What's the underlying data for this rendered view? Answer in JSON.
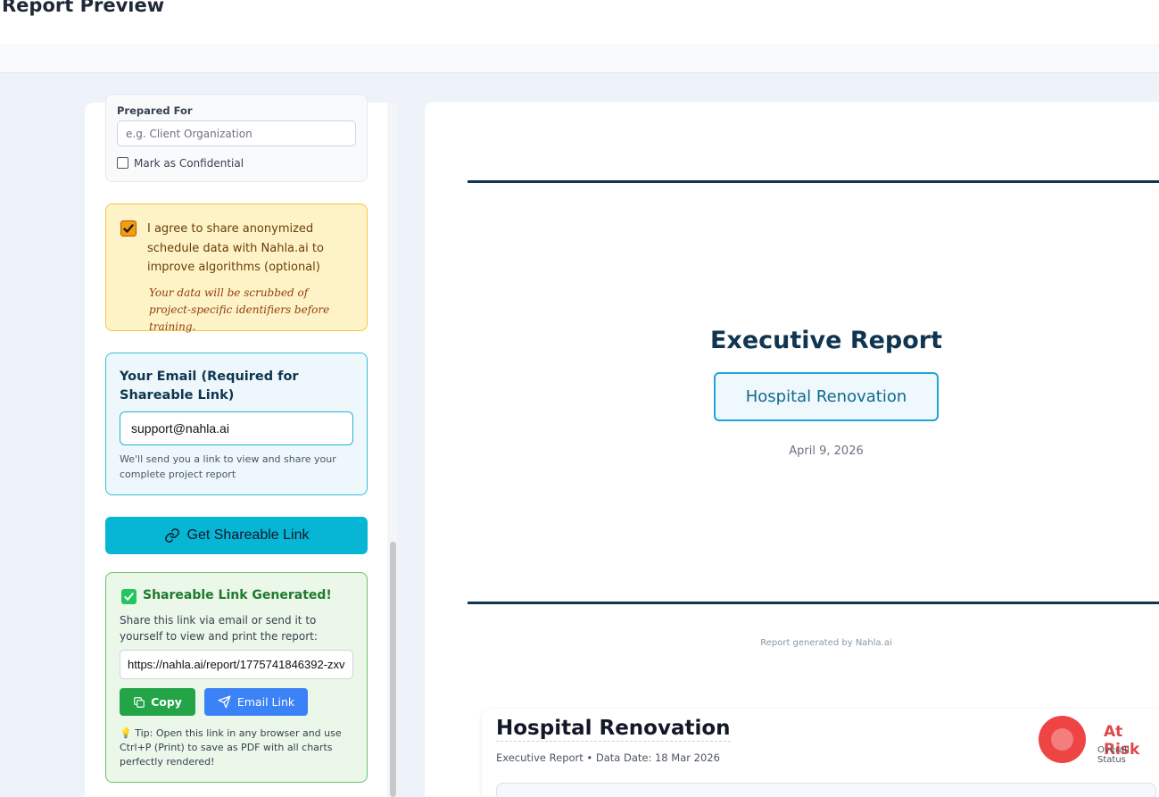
{
  "header": {
    "title": "Report Preview"
  },
  "sidebar": {
    "prepared_for": {
      "label": "Prepared For",
      "placeholder": "e.g. Client Organization",
      "value": ""
    },
    "confidential": {
      "label": "Mark as Confidential",
      "checked": false
    },
    "consent": {
      "checked": true,
      "text": "I agree to share anonymized schedule data with Nahla.ai to improve algorithms (optional)",
      "note": "Your data will be scrubbed of project-specific identifiers before training."
    },
    "email": {
      "title": "Your Email (Required for Shareable Link)",
      "value": "support@nahla.ai",
      "hint": "We'll send you a link to view and share your complete project report"
    },
    "share_button": {
      "label": "Get Shareable Link",
      "icon": "link-icon"
    },
    "generated": {
      "title": "Shareable Link Generated!",
      "description": "Share this link via email or send it to yourself to view and print the report:",
      "link": "https://nahla.ai/report/1775741846392-zxv",
      "copy_label": "Copy",
      "email_label": "Email Link",
      "tip": "Tip: Open this link in any browser and use Ctrl+P (Print) to save as PDF with all charts perfectly rendered!"
    }
  },
  "report": {
    "title": "Executive Report",
    "project": "Hospital Renovation",
    "date": "April 9, 2026",
    "footer": "Report generated by Nahla.ai",
    "summary_card": {
      "title": "Hospital Renovation",
      "subtitle": "Executive Report • Data Date: 18 Mar 2026",
      "status": "At Risk",
      "status_sub": "Overall Status",
      "status_color": "#ef4444"
    }
  },
  "colors": {
    "accent": "#06b6d4",
    "navy": "#0f3550",
    "success": "#22a447",
    "primary": "#3b82f6",
    "warning_bg": "#fef3c7"
  }
}
